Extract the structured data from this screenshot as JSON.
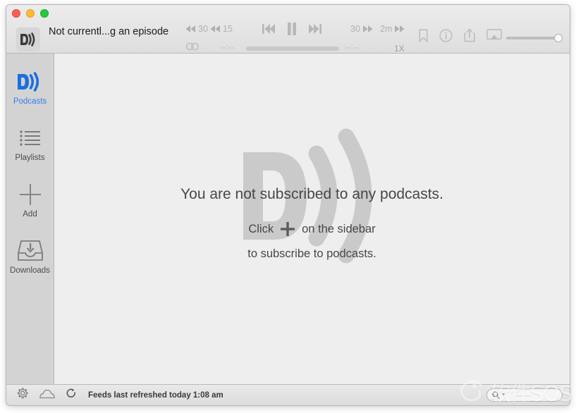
{
  "window": {
    "traffic_lights": [
      {
        "name": "close",
        "color": "#ff5f57"
      },
      {
        "name": "minimize",
        "color": "#febc2e"
      },
      {
        "name": "zoom",
        "color": "#28c840"
      }
    ],
    "app_icon": "downcast-app-icon"
  },
  "toolbar": {
    "now_playing_title": "Not currentl...g an episode",
    "skip_back_30": "30",
    "skip_back_15": "15",
    "skip_forward_30": "30",
    "skip_forward_2m": "2m",
    "previous_label": "previous-track-icon",
    "pause_label": "pause-icon",
    "next_label": "next-track-icon",
    "loop_label": "loop-icon",
    "elapsed_time": "--:--",
    "remaining_time": "--:--",
    "playback_speed": "1X",
    "right_icons": [
      {
        "name": "bookmark-icon"
      },
      {
        "name": "info-icon"
      },
      {
        "name": "share-icon"
      },
      {
        "name": "airplay-icon"
      }
    ],
    "volume": {
      "level_percent": 100
    }
  },
  "sidebar": {
    "items": [
      {
        "label": "Podcasts",
        "icon": "podcasts-icon",
        "active": true
      },
      {
        "label": "Playlists",
        "icon": "playlists-icon",
        "active": false
      },
      {
        "label": "Add",
        "icon": "plus-icon",
        "active": false
      },
      {
        "label": "Downloads",
        "icon": "downloads-icon",
        "active": false
      }
    ]
  },
  "main": {
    "background_logo": "downcast-watermark-logo",
    "empty_state": {
      "line1": "You are not subscribed to any podcasts.",
      "line2_prefix": "Click",
      "line2_suffix": "on the sidebar",
      "line3": "to subscribe to podcasts."
    }
  },
  "statusbar": {
    "icons": [
      {
        "name": "gear-icon"
      },
      {
        "name": "cloud-icon"
      },
      {
        "name": "refresh-icon"
      }
    ],
    "status_text": "Feeds last refreshed today 1:08 am",
    "search": {
      "placeholder": "",
      "value": "",
      "icon": "search-icon"
    }
  },
  "watermark": {
    "text": "软件SOS",
    "logo": "swirl-logo"
  },
  "colors": {
    "accent_blue": "#2d7ff0",
    "sidebar_bg": "#d3d3d3",
    "content_bg": "#eeeeee",
    "toolbar_bg": "#e4e4e4",
    "icon_gray": "#8d8d8d",
    "logo_gray": "#c9c9c9"
  }
}
